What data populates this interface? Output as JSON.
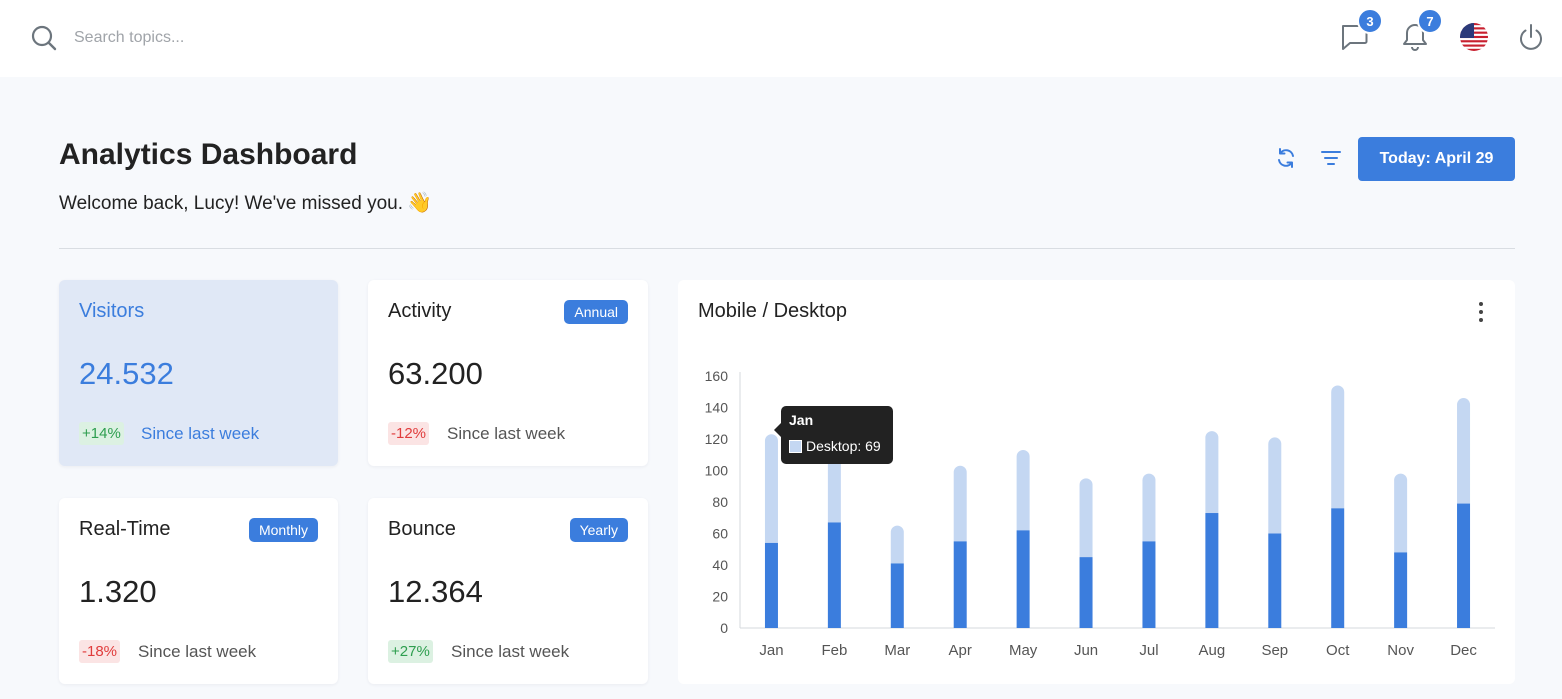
{
  "topbar": {
    "search_placeholder": "Search topics...",
    "messages_count": "3",
    "notifications_count": "7",
    "language": "English (US)"
  },
  "header": {
    "title": "Analytics Dashboard",
    "welcome": "Welcome back, Lucy! We've missed you.",
    "wave_emoji": "👋",
    "today_button": "Today: April 29"
  },
  "stats": [
    {
      "title": "Visitors",
      "value": "24.532",
      "delta": "+14%",
      "trend": "up",
      "since": "Since last week",
      "badge": ""
    },
    {
      "title": "Activity",
      "value": "63.200",
      "delta": "-12%",
      "trend": "down",
      "since": "Since last week",
      "badge": "Annual"
    },
    {
      "title": "Real-Time",
      "value": "1.320",
      "delta": "-18%",
      "trend": "down",
      "since": "Since last week",
      "badge": "Monthly"
    },
    {
      "title": "Bounce",
      "value": "12.364",
      "delta": "+27%",
      "trend": "up",
      "since": "Since last week",
      "badge": "Yearly"
    }
  ],
  "colors": {
    "accent": "#3b7ddd",
    "mobile": "#3b7ddd",
    "desktop": "#c4d7f2",
    "positive": "#2e9e4f",
    "negative": "#e03b3b"
  },
  "chart_data": {
    "type": "bar",
    "title": "Mobile / Desktop",
    "stacked": true,
    "categories": [
      "Jan",
      "Feb",
      "Mar",
      "Apr",
      "May",
      "Jun",
      "Jul",
      "Aug",
      "Sep",
      "Oct",
      "Nov",
      "Dec"
    ],
    "series": [
      {
        "name": "Mobile",
        "values": [
          54,
          67,
          41,
          55,
          62,
          45,
          55,
          73,
          60,
          76,
          48,
          79
        ]
      },
      {
        "name": "Desktop",
        "values": [
          69,
          66,
          24,
          48,
          51,
          50,
          43,
          52,
          61,
          78,
          50,
          67
        ]
      }
    ],
    "ylim": [
      0,
      160
    ],
    "yticks": [
      0,
      20,
      40,
      60,
      80,
      100,
      120,
      140,
      160
    ],
    "grid": false,
    "tooltip": {
      "title": "Jan",
      "label": "Desktop: 69"
    }
  }
}
